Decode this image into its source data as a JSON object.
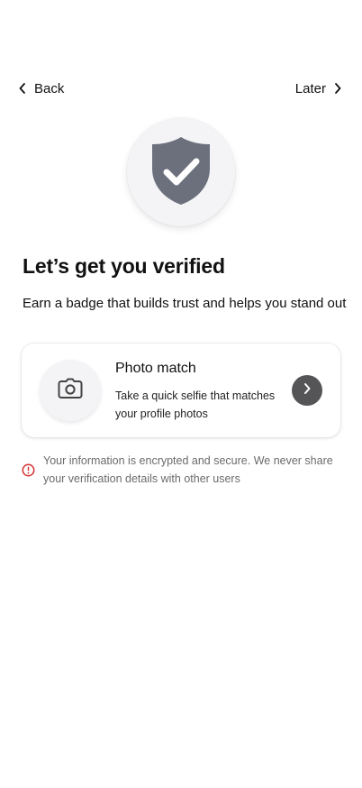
{
  "nav": {
    "back_label": "Back",
    "later_label": "Later"
  },
  "header": {
    "title": "Let’s get you verified",
    "subtitle": "Earn a badge that builds trust and helps you stand out"
  },
  "option": {
    "title": "Photo match",
    "description": "Take a quick selfie that matches your profile photos"
  },
  "notice": {
    "text": "Your information is encrypted and secure. We never share your verification details with other users"
  },
  "icons": {
    "back": "chevron-left-icon",
    "later": "chevron-right-icon",
    "badge": "shield-check-icon",
    "camera": "camera-icon",
    "arrow": "chevron-right-icon",
    "notice": "alert-circle-icon"
  },
  "colors": {
    "shield": "#6b707c",
    "arrow_button": "#555558",
    "alert": "#d32f2f",
    "muted_text": "#6b6b6b"
  }
}
